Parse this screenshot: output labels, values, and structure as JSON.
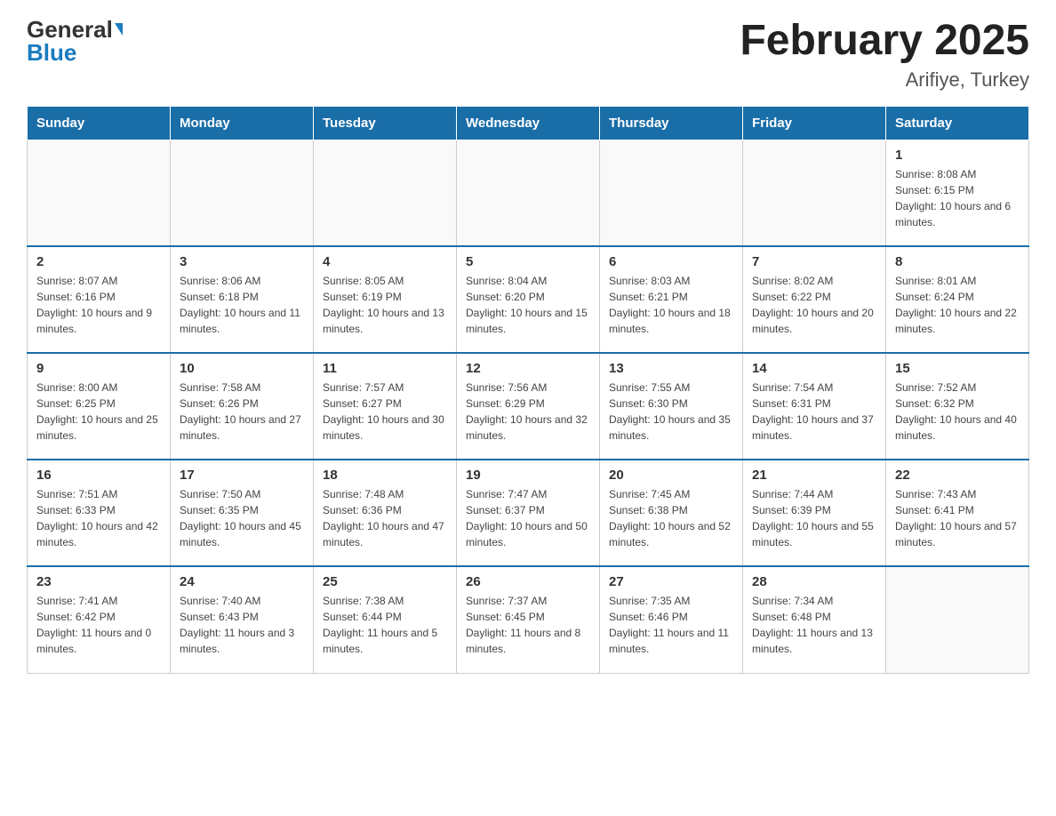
{
  "logo": {
    "general": "General",
    "blue": "Blue"
  },
  "title": "February 2025",
  "subtitle": "Arifiye, Turkey",
  "days_of_week": [
    "Sunday",
    "Monday",
    "Tuesday",
    "Wednesday",
    "Thursday",
    "Friday",
    "Saturday"
  ],
  "weeks": [
    [
      {
        "day": "",
        "info": ""
      },
      {
        "day": "",
        "info": ""
      },
      {
        "day": "",
        "info": ""
      },
      {
        "day": "",
        "info": ""
      },
      {
        "day": "",
        "info": ""
      },
      {
        "day": "",
        "info": ""
      },
      {
        "day": "1",
        "info": "Sunrise: 8:08 AM\nSunset: 6:15 PM\nDaylight: 10 hours and 6 minutes."
      }
    ],
    [
      {
        "day": "2",
        "info": "Sunrise: 8:07 AM\nSunset: 6:16 PM\nDaylight: 10 hours and 9 minutes."
      },
      {
        "day": "3",
        "info": "Sunrise: 8:06 AM\nSunset: 6:18 PM\nDaylight: 10 hours and 11 minutes."
      },
      {
        "day": "4",
        "info": "Sunrise: 8:05 AM\nSunset: 6:19 PM\nDaylight: 10 hours and 13 minutes."
      },
      {
        "day": "5",
        "info": "Sunrise: 8:04 AM\nSunset: 6:20 PM\nDaylight: 10 hours and 15 minutes."
      },
      {
        "day": "6",
        "info": "Sunrise: 8:03 AM\nSunset: 6:21 PM\nDaylight: 10 hours and 18 minutes."
      },
      {
        "day": "7",
        "info": "Sunrise: 8:02 AM\nSunset: 6:22 PM\nDaylight: 10 hours and 20 minutes."
      },
      {
        "day": "8",
        "info": "Sunrise: 8:01 AM\nSunset: 6:24 PM\nDaylight: 10 hours and 22 minutes."
      }
    ],
    [
      {
        "day": "9",
        "info": "Sunrise: 8:00 AM\nSunset: 6:25 PM\nDaylight: 10 hours and 25 minutes."
      },
      {
        "day": "10",
        "info": "Sunrise: 7:58 AM\nSunset: 6:26 PM\nDaylight: 10 hours and 27 minutes."
      },
      {
        "day": "11",
        "info": "Sunrise: 7:57 AM\nSunset: 6:27 PM\nDaylight: 10 hours and 30 minutes."
      },
      {
        "day": "12",
        "info": "Sunrise: 7:56 AM\nSunset: 6:29 PM\nDaylight: 10 hours and 32 minutes."
      },
      {
        "day": "13",
        "info": "Sunrise: 7:55 AM\nSunset: 6:30 PM\nDaylight: 10 hours and 35 minutes."
      },
      {
        "day": "14",
        "info": "Sunrise: 7:54 AM\nSunset: 6:31 PM\nDaylight: 10 hours and 37 minutes."
      },
      {
        "day": "15",
        "info": "Sunrise: 7:52 AM\nSunset: 6:32 PM\nDaylight: 10 hours and 40 minutes."
      }
    ],
    [
      {
        "day": "16",
        "info": "Sunrise: 7:51 AM\nSunset: 6:33 PM\nDaylight: 10 hours and 42 minutes."
      },
      {
        "day": "17",
        "info": "Sunrise: 7:50 AM\nSunset: 6:35 PM\nDaylight: 10 hours and 45 minutes."
      },
      {
        "day": "18",
        "info": "Sunrise: 7:48 AM\nSunset: 6:36 PM\nDaylight: 10 hours and 47 minutes."
      },
      {
        "day": "19",
        "info": "Sunrise: 7:47 AM\nSunset: 6:37 PM\nDaylight: 10 hours and 50 minutes."
      },
      {
        "day": "20",
        "info": "Sunrise: 7:45 AM\nSunset: 6:38 PM\nDaylight: 10 hours and 52 minutes."
      },
      {
        "day": "21",
        "info": "Sunrise: 7:44 AM\nSunset: 6:39 PM\nDaylight: 10 hours and 55 minutes."
      },
      {
        "day": "22",
        "info": "Sunrise: 7:43 AM\nSunset: 6:41 PM\nDaylight: 10 hours and 57 minutes."
      }
    ],
    [
      {
        "day": "23",
        "info": "Sunrise: 7:41 AM\nSunset: 6:42 PM\nDaylight: 11 hours and 0 minutes."
      },
      {
        "day": "24",
        "info": "Sunrise: 7:40 AM\nSunset: 6:43 PM\nDaylight: 11 hours and 3 minutes."
      },
      {
        "day": "25",
        "info": "Sunrise: 7:38 AM\nSunset: 6:44 PM\nDaylight: 11 hours and 5 minutes."
      },
      {
        "day": "26",
        "info": "Sunrise: 7:37 AM\nSunset: 6:45 PM\nDaylight: 11 hours and 8 minutes."
      },
      {
        "day": "27",
        "info": "Sunrise: 7:35 AM\nSunset: 6:46 PM\nDaylight: 11 hours and 11 minutes."
      },
      {
        "day": "28",
        "info": "Sunrise: 7:34 AM\nSunset: 6:48 PM\nDaylight: 11 hours and 13 minutes."
      },
      {
        "day": "",
        "info": ""
      }
    ]
  ]
}
